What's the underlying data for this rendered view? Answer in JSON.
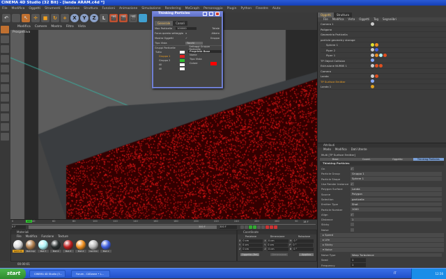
{
  "window": {
    "title": "CINEMA 4D Studio (32 Bit) - [landa ARAM.c4d *]"
  },
  "menu": [
    "File",
    "Modifica",
    "Oggetti",
    "Strumenti",
    "Selezione",
    "Struttura",
    "Funzioni",
    "Animazione",
    "Simulazione",
    "Rendering",
    "MoGraph",
    "Personaggio",
    "Plugin",
    "Python",
    "Finestre",
    "Aiuto"
  ],
  "toolbar": {
    "x": "X",
    "y": "Y",
    "z": "Z"
  },
  "viewport": {
    "menu": [
      "Modifica",
      "Camere",
      "Mostra",
      "Filtro",
      "Vista"
    ],
    "label": "Prospettiva",
    "particle_color": "#ff1a1a"
  },
  "dialog": {
    "title": "Thinking Particles",
    "tabs": [
      "Generale",
      "Canali"
    ],
    "max_particles_label": "Max Particelle",
    "max_particles": "100000",
    "totale": "Totale",
    "force_label": "Forza questo settaggio",
    "albero": "Albero",
    "show_objects_label": "Mostra Oggetti",
    "gruppo": "Gruppo",
    "view_type_label": "Tipo Vista",
    "view_type": "Tocchi",
    "groups_header": "Gruppi Particelle",
    "settings_header": "Settaggi Gruppo Particelle",
    "groups": [
      {
        "name": "Tutto",
        "color": "#ffffff"
      },
      {
        "name": "Gruppo 1",
        "color": "#e02020"
      },
      {
        "name": "Gruppo 2",
        "color": "#30c030"
      },
      {
        "name": "All",
        "color": "#ffffff"
      },
      {
        "name": "All",
        "color": "#ffffff"
      }
    ],
    "prop_header": "Proprietà Base",
    "prop_name": "Nome",
    "prop_viewtype": "Tipo Vista",
    "prop_color": "Colore",
    "prop_color_value": "#ff0000"
  },
  "objects": {
    "tabs": [
      "Oggetti",
      "Struttura"
    ],
    "menu": [
      "File",
      "Modifica",
      "Vista",
      "Oggetti",
      "Tag",
      "Segnalibri"
    ],
    "items": [
      "Camera 1",
      "Poligono",
      "Geometria Particella",
      "particle geometry storage",
      "Sphere 1",
      "Piper 2",
      "Piper 1",
      "TP Object Collision",
      "Estrusione NURBS 1",
      "Camera",
      "Landa",
      "TP Surface Emitter",
      "Landa 1"
    ]
  },
  "attributes": {
    "title": "Attributi",
    "menu": [
      "Modo",
      "Modifica",
      "Dati Utente"
    ],
    "object": "Multi [TP Surface Emitter]",
    "tabs": [
      "Base",
      "Coord.",
      "Oggetto",
      "Thinking Particles"
    ],
    "section": "Thinking Particles",
    "rows": [
      {
        "label": "On",
        "value": "✓"
      },
      {
        "label": "Particle Group",
        "value": "Gruppo 1"
      },
      {
        "label": "Particle Shape",
        "value": "Sphere 1"
      },
      {
        "label": "Use Render Instance",
        "value": "✓"
      },
      {
        "label": "Polygon Surface",
        "value": "Landa"
      },
      {
        "label": "Source",
        "value": "Polygon"
      },
      {
        "label": "Selection",
        "value": "particelle"
      },
      {
        "label": "Emitter Type",
        "value": "Shot"
      },
      {
        "label": "Particle Number",
        "value": "1000"
      },
      {
        "label": "Align",
        "value": "✓"
      },
      {
        "label": "Distance",
        "value": "1"
      },
      {
        "label": "Sticky",
        "value": ""
      },
      {
        "label": "Noise",
        "value": ""
      }
    ],
    "groups": [
      "Speed",
      "Life",
      "Sticky",
      "Noise"
    ],
    "noise_type_label": "Noise Type",
    "noise_type": "Warp Turbulence",
    "seed_label": "Seed",
    "seed": "1",
    "freq_label": "Frequency",
    "freq": "1"
  },
  "timeline": {
    "ticks": [
      "0",
      "40",
      "60",
      "80",
      "100",
      "120",
      "140",
      "160",
      "180",
      "200",
      "220",
      "240",
      "260",
      "280",
      "30"
    ],
    "current": "140",
    "current_frame": "0 F",
    "end": "300 F",
    "end2": "300 F",
    "fps": "18 F"
  },
  "materials": {
    "title": "Materiali",
    "menu": [
      "File",
      "Modifica",
      "Funzione",
      "Texture"
    ],
    "items": [
      {
        "name": "Gold Ch",
        "color": "#ddd"
      },
      {
        "name": "Mat.Cop",
        "color": "#b08050"
      },
      {
        "name": "Mat.7",
        "color": "#aef4f8"
      },
      {
        "name": "Mat.4",
        "color": "#2a3030"
      },
      {
        "name": "Mat.3",
        "color": "#c02020"
      },
      {
        "name": "Mat.2",
        "color": "#f09020"
      },
      {
        "name": "Cerchio",
        "color": "#bbb"
      },
      {
        "name": "Mat.1",
        "color": "#4060e0"
      }
    ]
  },
  "coords": {
    "title": "Coordinate",
    "headers": [
      "Posizione",
      "Dimensione",
      "Rotazione"
    ],
    "rows": [
      [
        "X",
        "0 cm",
        "X",
        "0 cm",
        "H",
        "0 °"
      ],
      [
        "Y",
        "0 cm",
        "Y",
        "0 cm",
        "P",
        "0 °"
      ],
      [
        "Z",
        "0 cm",
        "Z",
        "0 cm",
        "B",
        "0 °"
      ]
    ],
    "mode": "Oggetto (Rel)",
    "size_mode": "Dimensione",
    "apply": "Applica"
  },
  "status": {
    "time": "00:00:01"
  },
  "taskbar": {
    "start": "start",
    "tasks": [
      "CINEMA 4D Studio (3...",
      "Forum - C4Dzone • L..."
    ],
    "lang": "IT",
    "clock": "12.56"
  }
}
